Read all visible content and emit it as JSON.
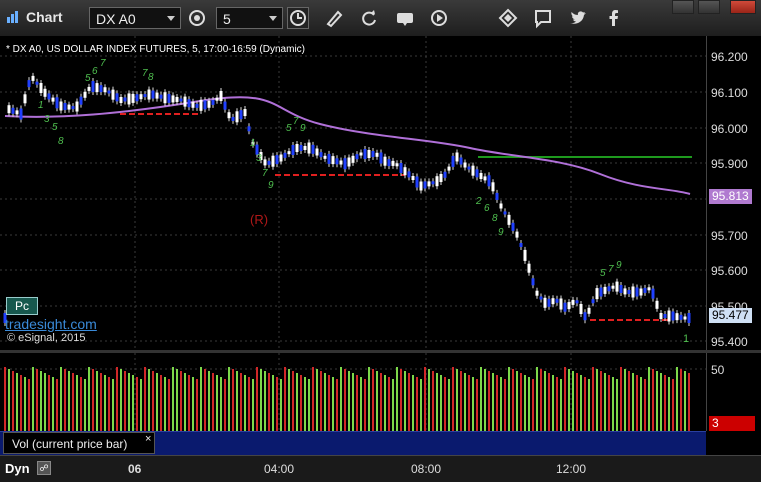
{
  "app": {
    "title": "Chart"
  },
  "toolbar": {
    "symbol": "DX A0",
    "interval": "5",
    "icons": [
      "settings-icon",
      "clock-icon",
      "pencil-icon",
      "refresh-icon",
      "get-icon",
      "play-icon",
      "diamond-icon",
      "speech-icon",
      "twitter-icon",
      "facebook-icon"
    ]
  },
  "chart": {
    "header": "* DX A0, US DOLLAR INDEX FUTURES, 5, 17:00-16:59 (Dynamic)",
    "marker_r": "(R)",
    "badge": "Pc",
    "watermark": "tradesight.com",
    "copyright": "© eSignal, 2015",
    "count_label": "1",
    "price_labels": [
      "96.200",
      "96.100",
      "96.000",
      "95.900",
      "95.700",
      "95.600",
      "95.500",
      "95.400"
    ],
    "ma_tag": "95.813",
    "last_tag": "95.477",
    "colors": {
      "ma": "#b070d8",
      "last_tag": "#cfe0f5",
      "ma_tag": "#b07ad0",
      "support": "#e02020",
      "resistance": "#1e9a1e",
      "down_candle": "#2040ff"
    }
  },
  "volume": {
    "label": "Vol (current price bar)",
    "close": "×",
    "axis_label": "50",
    "tag": "3"
  },
  "time_axis": {
    "mode": "Dyn",
    "labels": [
      "06",
      "04:00",
      "08:00",
      "12:00"
    ]
  }
}
